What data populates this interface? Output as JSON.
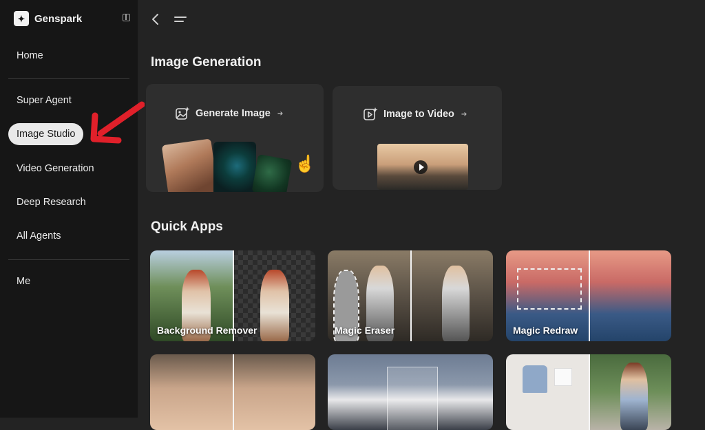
{
  "brand": {
    "name": "Genspark"
  },
  "sidebar": {
    "items": [
      {
        "label": "Home"
      },
      {
        "label": "Super Agent"
      },
      {
        "label": "Image Studio"
      },
      {
        "label": "Video Generation"
      },
      {
        "label": "Deep Research"
      },
      {
        "label": "All Agents"
      },
      {
        "label": "Me"
      }
    ],
    "active_item": "Image Studio"
  },
  "image_generation": {
    "title": "Image Generation",
    "cards": [
      {
        "label": "Generate Image",
        "icon": "image-sparkle-icon"
      },
      {
        "label": "Image to Video",
        "icon": "video-sparkle-icon"
      }
    ]
  },
  "quick_apps": {
    "title": "Quick Apps",
    "apps": [
      {
        "label": "Background Remover"
      },
      {
        "label": "Magic Eraser"
      },
      {
        "label": "Magic Redraw"
      }
    ]
  },
  "colors": {
    "sidebar_bg": "#161616",
    "main_bg": "#232323",
    "card_bg": "#2e2e2e",
    "active_pill": "#e9e9e9",
    "annotation_red": "#e0202a"
  }
}
